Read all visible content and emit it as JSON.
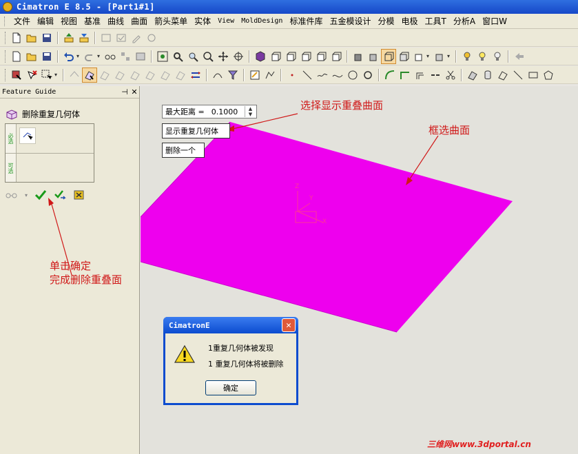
{
  "window": {
    "title": "Cimatron E 8.5 - [Part1#1]"
  },
  "menu": {
    "items": [
      "文件",
      "编辑",
      "视图",
      "基准",
      "曲线",
      "曲面",
      "箭头菜单",
      "实体",
      "View",
      "MoldDesign",
      "标准件库",
      "五金模设计",
      "分模",
      "电极",
      "工具T",
      "分析A",
      "窗口W"
    ]
  },
  "feature_guide": {
    "header": "Feature Guide",
    "pin_glyph": "⊣",
    "close_glyph": "✕",
    "step_title": "删除重复几何体",
    "row_required": "必选",
    "row_optional": "可选"
  },
  "params": {
    "max_distance_label": "最大距离 =",
    "max_distance_value": "0.1000",
    "show_button": "显示重复几何体",
    "delete_one_button": "删除一个"
  },
  "annotations": {
    "select_show": "选择显示重叠曲面",
    "box_select": "框选曲面",
    "click_confirm_1": "单击确定",
    "click_confirm_2": "完成删除重叠面"
  },
  "triad": {
    "z": "Z",
    "y": "Y",
    "x": "X"
  },
  "dialog": {
    "title": "CimatronE",
    "msg1": "1重复几何体被发现",
    "msg2": "1 重复几何体将被删除",
    "ok": "确定"
  },
  "watermark": "三维网www.3dportal.cn",
  "colors": {
    "surface": "#ee00ee",
    "annotation": "#d01818",
    "title_bar": "#1648c8"
  }
}
